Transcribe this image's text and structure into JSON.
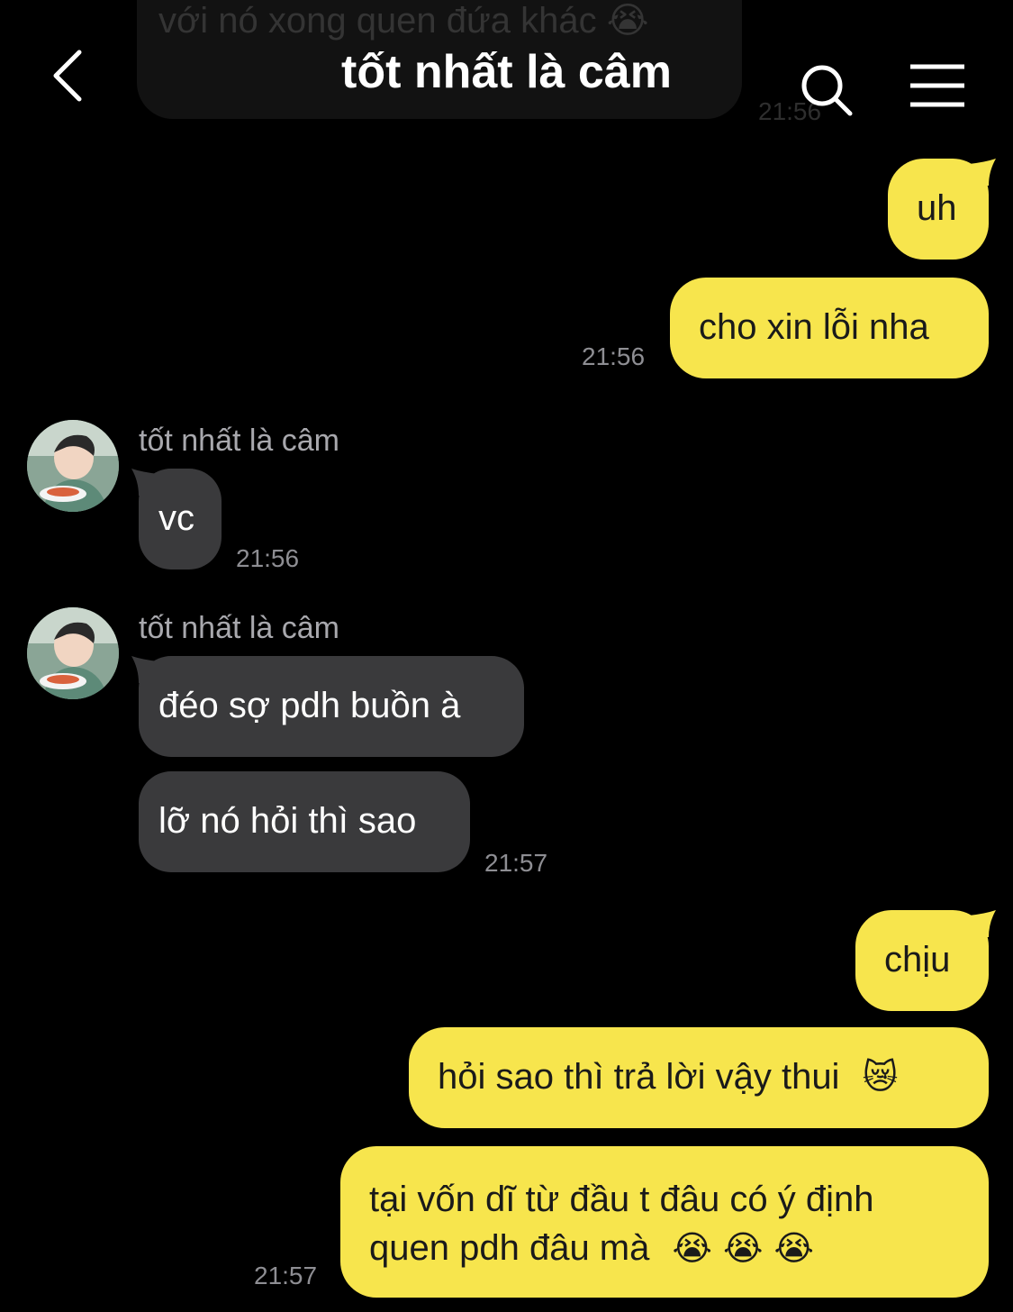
{
  "header": {
    "title": "tốt nhất là câm",
    "faded_message_text": "với nó xong quen đứa khác 😭",
    "faded_time": "21:56"
  },
  "messages": {
    "out1": "uh",
    "out2": "cho xin lỗi nha",
    "out2_time": "21:56",
    "in1_sender": "tốt nhất là câm",
    "in1": "vc",
    "in1_time": "21:56",
    "in2_sender": "tốt nhất là câm",
    "in2": "đéo sợ pdh buồn à",
    "in3": "lỡ nó hỏi thì sao",
    "in3_time": "21:57",
    "out3": "chịu",
    "out4": "hỏi sao thì trả lời vậy thui",
    "out4_emoji": "😿",
    "out5_line1": "tại vốn dĩ từ đầu t đâu có ý định",
    "out5_line2": "quen pdh đâu mà",
    "out5_emoji": "😭 😭 😭",
    "out5_time": "21:57"
  },
  "icons": {
    "back": "chevron-left-icon",
    "search": "search-icon",
    "menu": "hamburger-menu-icon"
  },
  "colors": {
    "background": "#000000",
    "outgoing_bubble": "#f7e54d",
    "incoming_bubble": "#3a3a3c",
    "timestamp": "#8e8e93"
  }
}
